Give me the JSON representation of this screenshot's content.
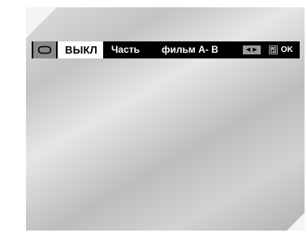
{
  "osd": {
    "repeat_icon": "repeat-icon",
    "mode_value": "ВЫКЛ",
    "options": [
      "Часть",
      "фильм  A- B"
    ],
    "nav_icon": "left-right-arrows-icon",
    "enter_icon": "enter-icon",
    "ok_label": "OK"
  },
  "colors": {
    "bar": "#000000",
    "selected_bg": "#ffffff",
    "icon_bg": "#8a8a8a",
    "screen": "#cccccc"
  }
}
